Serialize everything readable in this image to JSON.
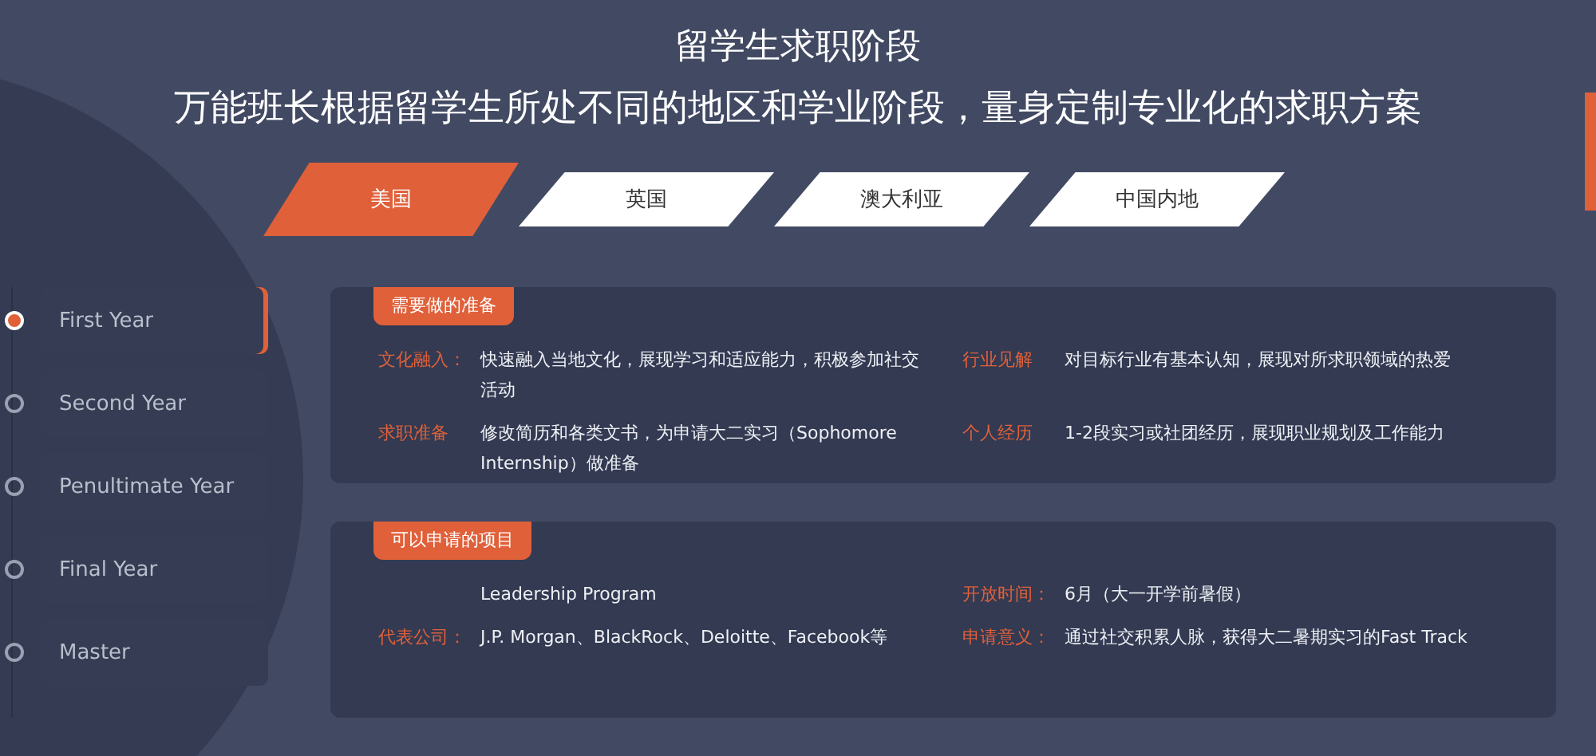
{
  "header": {
    "title": "留学生求职阶段",
    "subtitle": "万能班长根据留学生所处不同的地区和学业阶段，量身定制专业化的求职方案"
  },
  "tabs": [
    {
      "label": "美国",
      "selected": true
    },
    {
      "label": "英国",
      "selected": false
    },
    {
      "label": "澳大利亚",
      "selected": false
    },
    {
      "label": "中国内地",
      "selected": false
    }
  ],
  "stages": [
    {
      "label": "First Year",
      "selected": true
    },
    {
      "label": "Second Year",
      "selected": false
    },
    {
      "label": "Penultimate Year",
      "selected": false
    },
    {
      "label": "Final Year",
      "selected": false
    },
    {
      "label": "Master",
      "selected": false
    }
  ],
  "cards": [
    {
      "title": "需要做的准备",
      "fields": [
        {
          "label": "文化融入：",
          "value": "快速融入当地文化，展现学习和适应能力，积极参加社交活动"
        },
        {
          "label": "行业见解",
          "value": "对目标行业有基本认知，展现对所求职领域的热爱"
        },
        {
          "label": "求职准备",
          "value": "修改简历和各类文书，为申请大二实习（Sophomore Internship）做准备"
        },
        {
          "label": "个人经历",
          "value": "1-2段实习或社团经历，展现职业规划及工作能力"
        }
      ]
    },
    {
      "title": "可以申请的项目",
      "fields": [
        {
          "value": "Leadership Program"
        },
        {
          "label": "开放时间：",
          "value": "6月（大一开学前暑假）"
        },
        {
          "label": "代表公司：",
          "value": "J.P. Morgan、BlackRock、Deloitte、Facebook等"
        },
        {
          "label": "申请意义：",
          "value": "通过社交积累人脉，获得大二暑期实习的Fast Track"
        }
      ]
    }
  ]
}
